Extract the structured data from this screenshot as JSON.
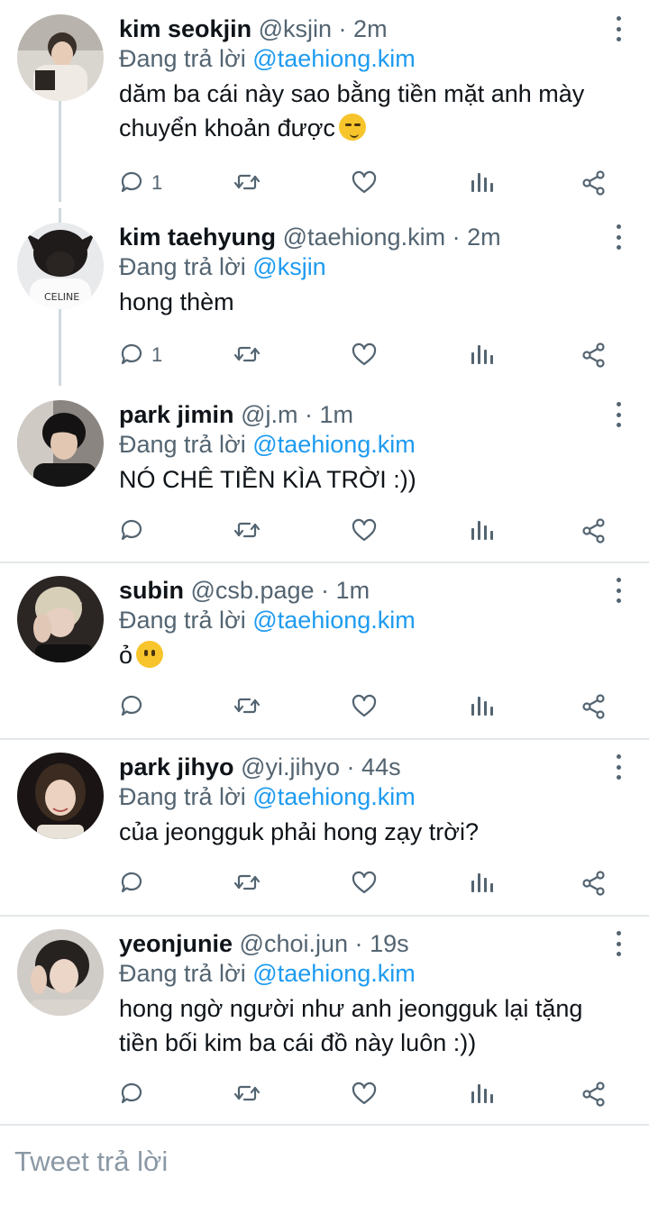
{
  "reply_prefix": "Đang trả lời",
  "dot_separator": "·",
  "colors": {
    "link": "#1d9bf0",
    "secondary_text": "#536471",
    "divider": "#e4e7ea",
    "thread_line": "#cfd9de"
  },
  "icons": {
    "more": "more-vertical-icon",
    "reply": "reply-icon",
    "retweet": "retweet-icon",
    "like": "heart-icon",
    "views": "views-icon",
    "share": "share-icon"
  },
  "tweets": [
    {
      "name": "kim seokjin",
      "handle": "@ksjin",
      "time": "2m",
      "reply_to": "@taehiong.kim",
      "lines": [
        "dăm ba cái này sao bằng tiền mặt anh mày",
        "chuyển khoản được"
      ],
      "emoji": "smirking-face",
      "reply_count": "1"
    },
    {
      "name": "kim taehyung",
      "handle": "@taehiong.kim",
      "time": "2m",
      "reply_to": "@ksjin",
      "lines": [
        "hong thèm"
      ],
      "reply_count": "1",
      "avatar_shirt_text": "CELINE"
    },
    {
      "name": "park jimin",
      "handle": "@j.m",
      "time": "1m",
      "reply_to": "@taehiong.kim",
      "lines": [
        "NÓ CHÊ TIỀN KÌA TRỜI :))"
      ],
      "reply_count": ""
    },
    {
      "name": "subin",
      "handle": "@csb.page",
      "time": "1m",
      "reply_to": "@taehiong.kim",
      "lines": [
        "ỏ"
      ],
      "emoji": "hushed-face",
      "reply_count": ""
    },
    {
      "name": "park jihyo",
      "handle": "@yi.jihyo",
      "time": "44s",
      "reply_to": "@taehiong.kim",
      "lines": [
        "của jeongguk phải hong zạy trời?"
      ],
      "reply_count": ""
    },
    {
      "name": "yeonjunie",
      "handle": "@choi.jun",
      "time": "19s",
      "reply_to": "@taehiong.kim",
      "lines": [
        "hong ngờ người như anh jeongguk lại tặng",
        "tiền bối kim ba cái đồ này luôn :))"
      ],
      "reply_count": ""
    }
  ],
  "reply_bar": {
    "placeholder": "Tweet trả lời"
  }
}
